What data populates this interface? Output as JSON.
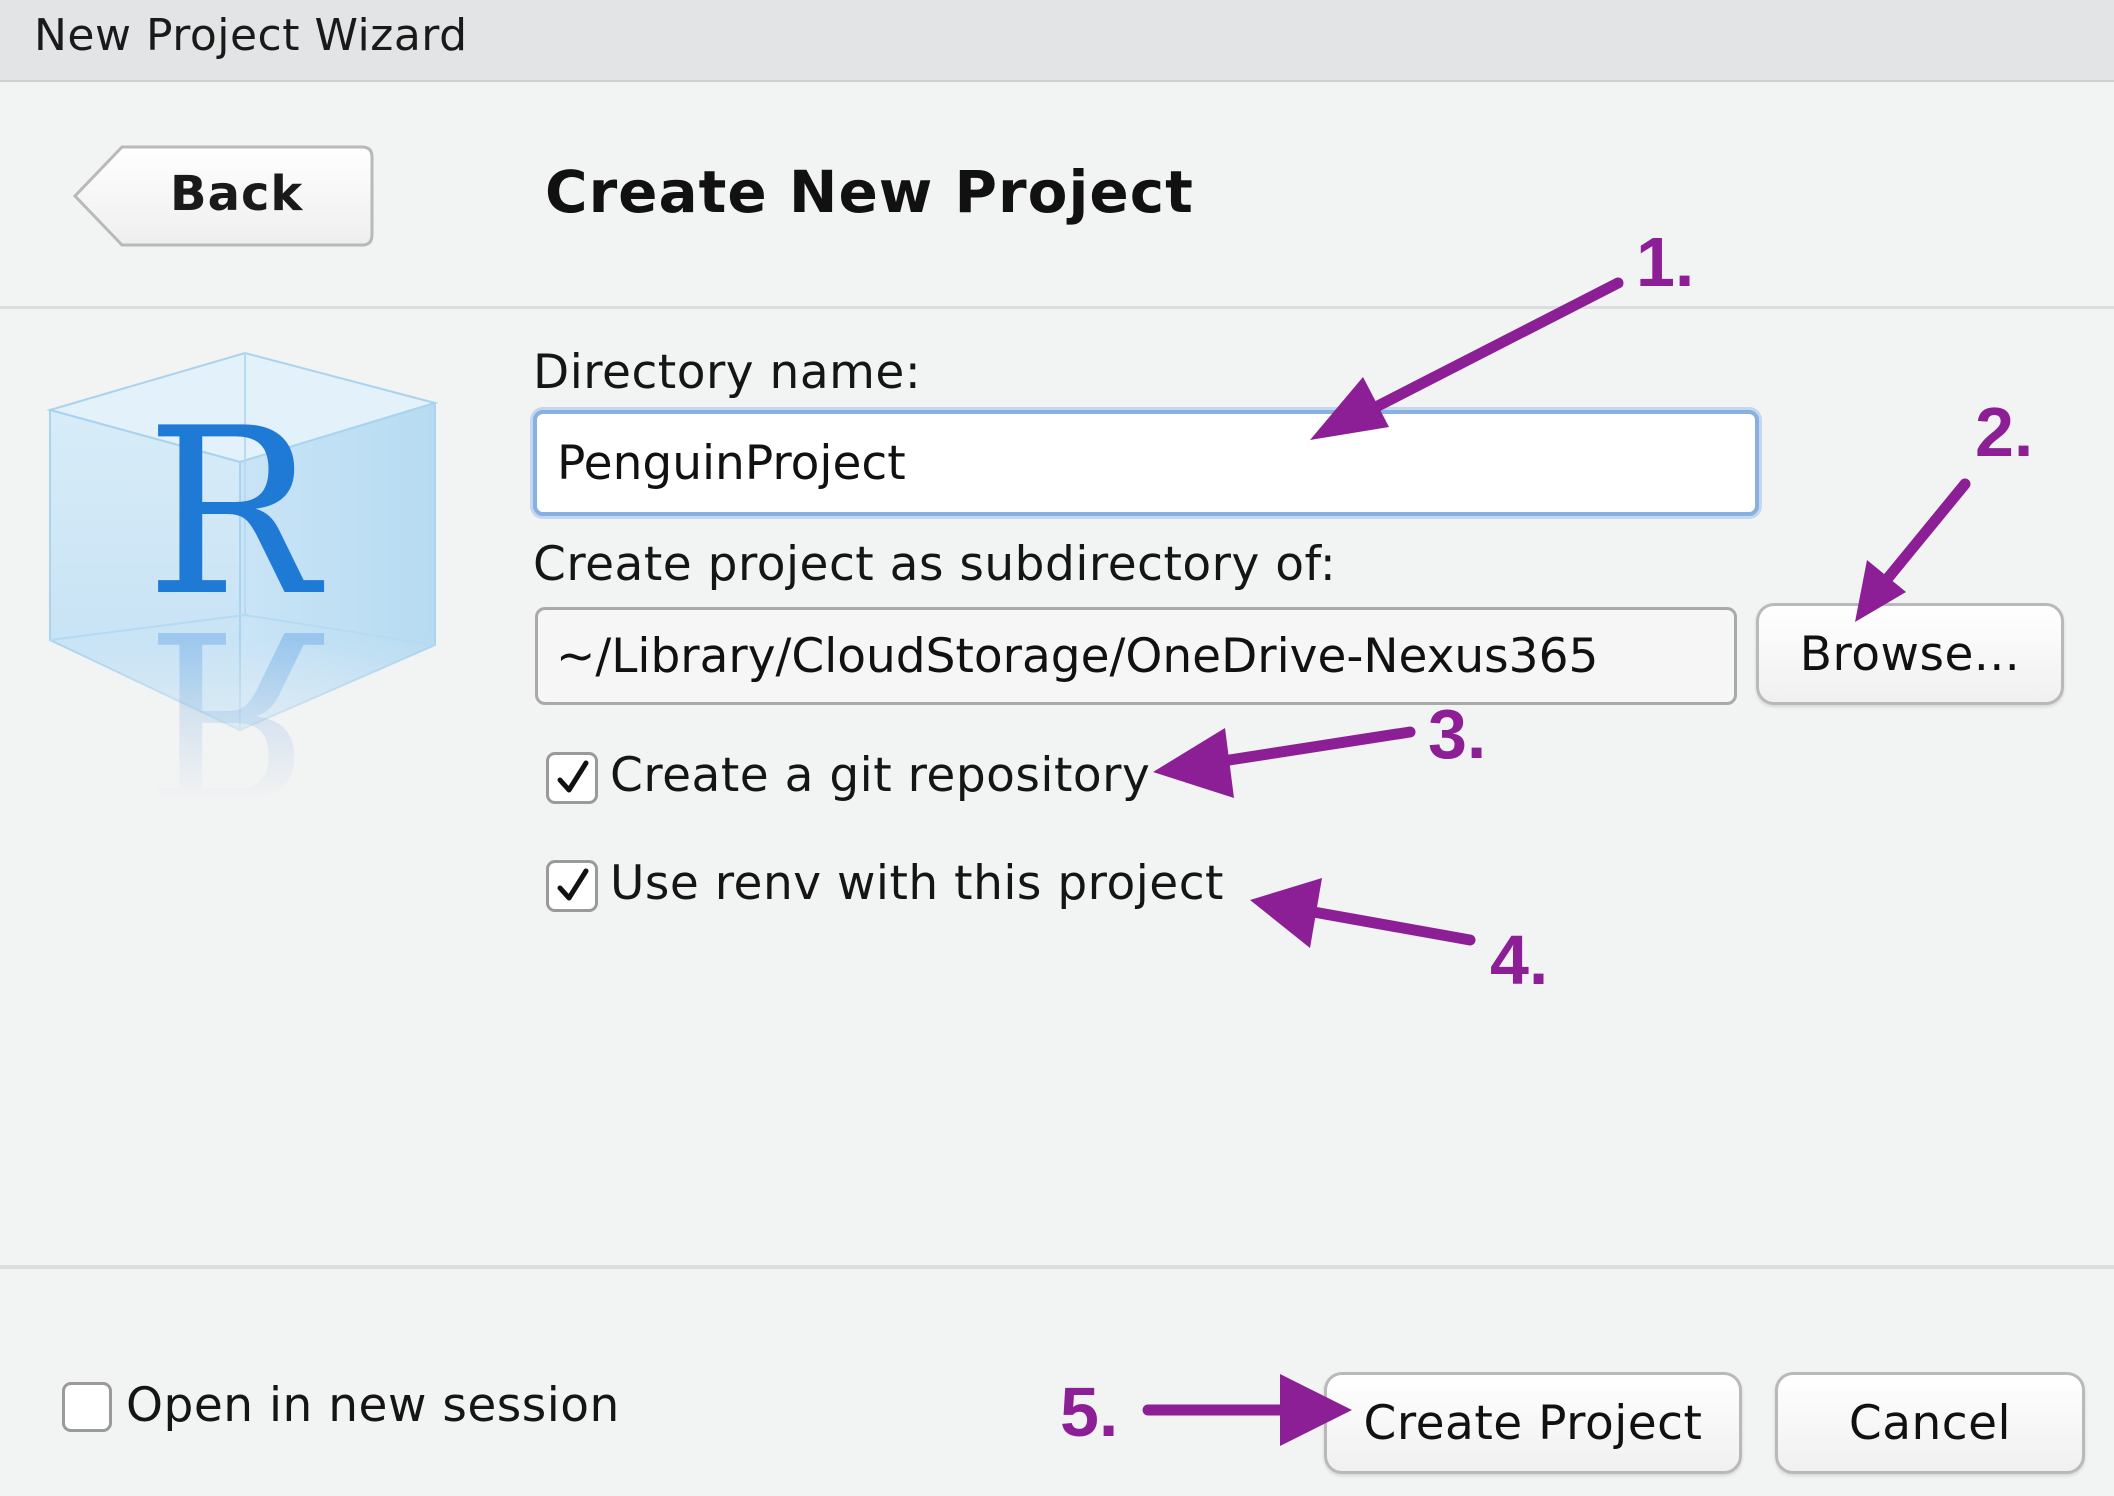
{
  "window": {
    "title": "New Project Wizard"
  },
  "header": {
    "back_label": "Back",
    "page_title": "Create New Project"
  },
  "logo": {
    "letter": "R"
  },
  "form": {
    "directory_label": "Directory name:",
    "directory_value": "PenguinProject",
    "parent_label": "Create project as subdirectory of:",
    "parent_value": "~/Library/CloudStorage/OneDrive-Nexus365",
    "browse_label": "Browse...",
    "git_label": "Create a git repository",
    "git_checked": true,
    "renv_label": "Use renv with this project",
    "renv_checked": true
  },
  "footer": {
    "new_session_label": "Open in new session",
    "new_session_checked": false,
    "create_label": "Create Project",
    "cancel_label": "Cancel"
  },
  "annotations": {
    "color": "#8c1f95",
    "steps": [
      "1.",
      "2.",
      "3.",
      "4.",
      "5."
    ]
  },
  "colors": {
    "accent": "#8c1f95",
    "focus_ring": "#8ab0e0",
    "r_blue": "#1f7ad6"
  }
}
